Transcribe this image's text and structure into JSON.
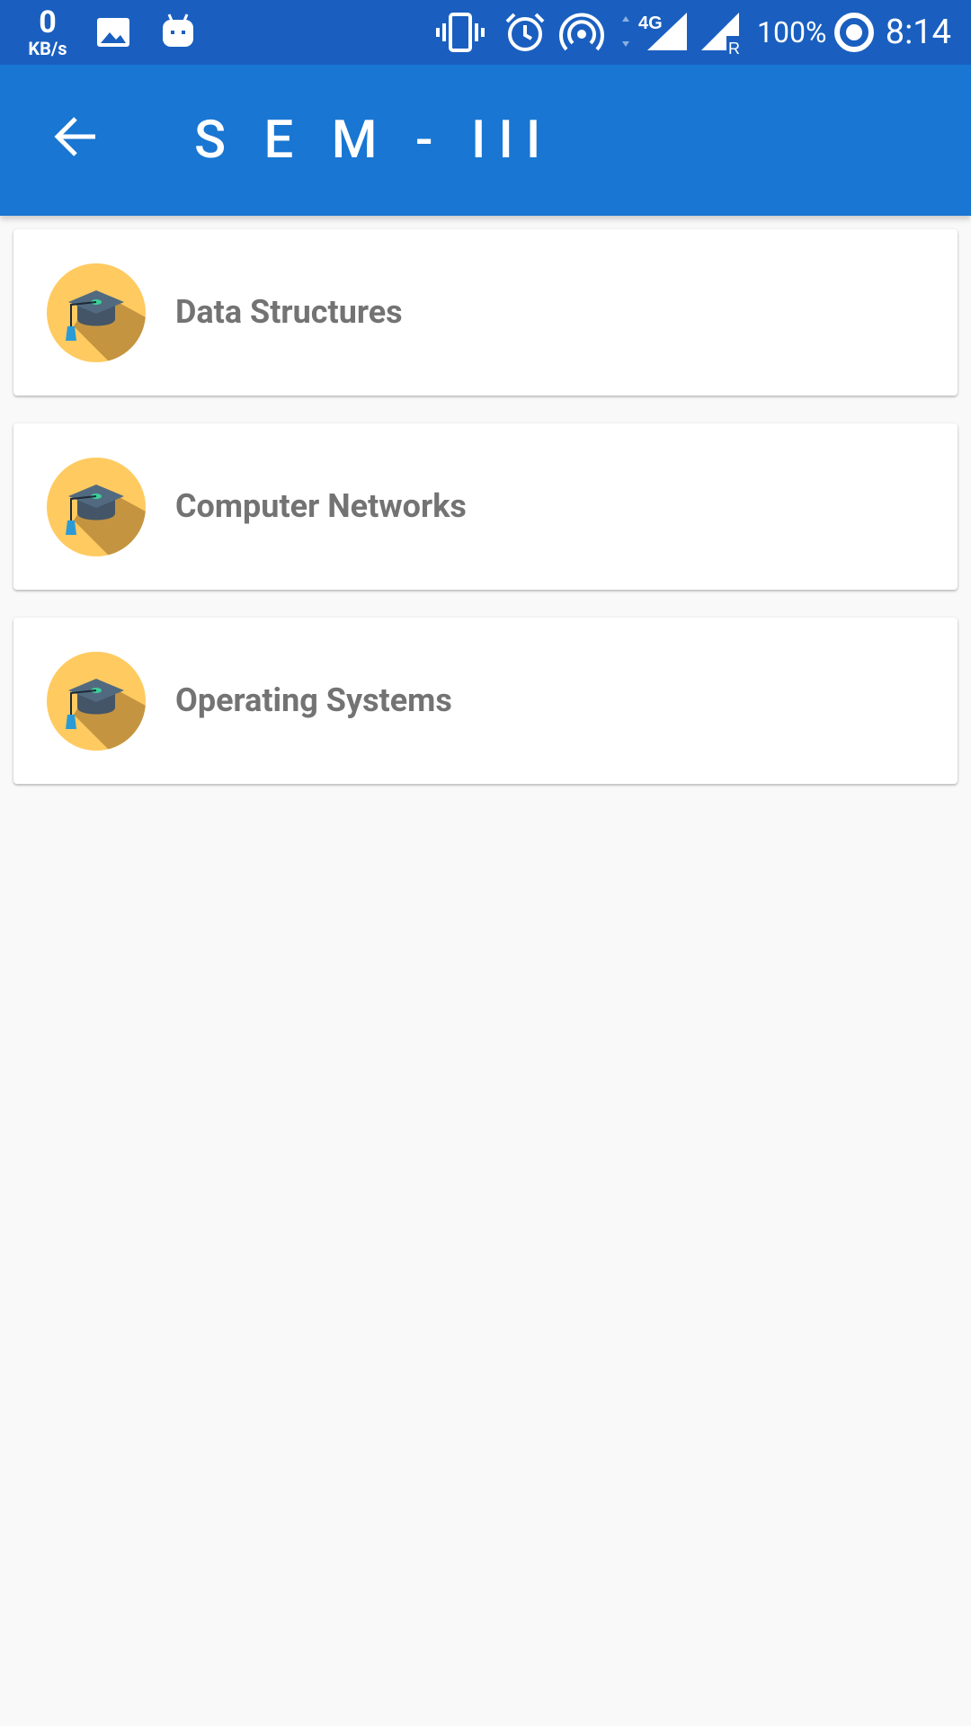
{
  "status_bar": {
    "net_speed_value": "0",
    "net_speed_unit": "KB/s",
    "battery": "100%",
    "time": "8:14",
    "icons": [
      "image-icon",
      "android-icon",
      "vibrate-icon",
      "alarm-icon",
      "hotspot-icon",
      "signal-4g-icon",
      "signal-roaming-icon",
      "battery-ring-icon"
    ],
    "network_label": "4G",
    "roaming_label": "R"
  },
  "app_bar": {
    "title": "S E M - III",
    "back_icon": "arrow-back-icon",
    "background": "#1976d2"
  },
  "subjects": [
    {
      "label": "Data Structures",
      "icon": "graduation-cap-icon"
    },
    {
      "label": "Computer Networks",
      "icon": "graduation-cap-icon"
    },
    {
      "label": "Operating Systems",
      "icon": "graduation-cap-icon"
    }
  ],
  "colors": {
    "status_bar": "#1a5fc0",
    "icon_circle": "#ffca60",
    "icon_shadow": "#c49440",
    "cap": "#435567",
    "tassel": "#2a9bd6",
    "cap_button": "#3ccf9a",
    "label_text": "#737373"
  }
}
